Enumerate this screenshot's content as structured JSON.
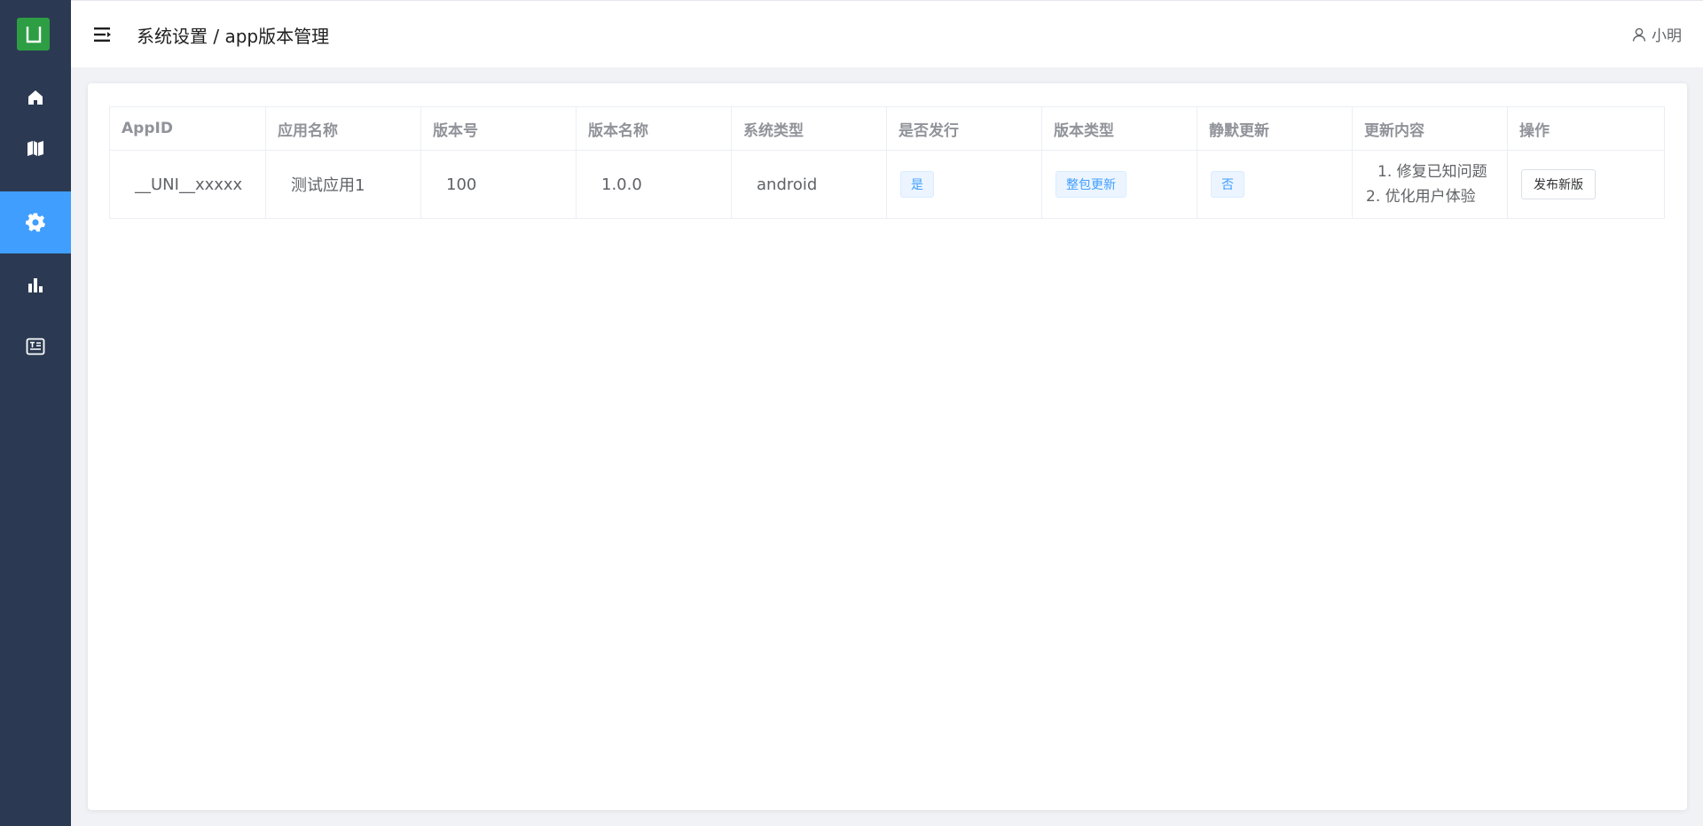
{
  "sidebar": {
    "logo_icon": "uni-logo-icon",
    "items": [
      {
        "icon": "home-icon"
      },
      {
        "icon": "map-icon"
      },
      {
        "icon": "settings-icon",
        "active": true
      },
      {
        "icon": "bar-chart-icon"
      },
      {
        "icon": "document-icon"
      }
    ],
    "bg_color": "#2b3a52",
    "active_color": "#409eff"
  },
  "header": {
    "breadcrumb": "系统设置 / app版本管理",
    "user_name": "小明"
  },
  "table": {
    "columns": [
      "AppID",
      "应用名称",
      "版本号",
      "版本名称",
      "系统类型",
      "是否发行",
      "版本类型",
      "静默更新",
      "更新内容",
      "操作"
    ],
    "rows": [
      {
        "appid": "__UNI__xxxxx",
        "app_name": "测试应用1",
        "version_code": "100",
        "version_name": "1.0.0",
        "platform": "android",
        "is_released": "是",
        "version_type": "整包更新",
        "silent_update": "否",
        "update_content": [
          "1. 修复已知问题",
          "2. 优化用户体验"
        ],
        "action_label": "发布新版"
      }
    ]
  }
}
